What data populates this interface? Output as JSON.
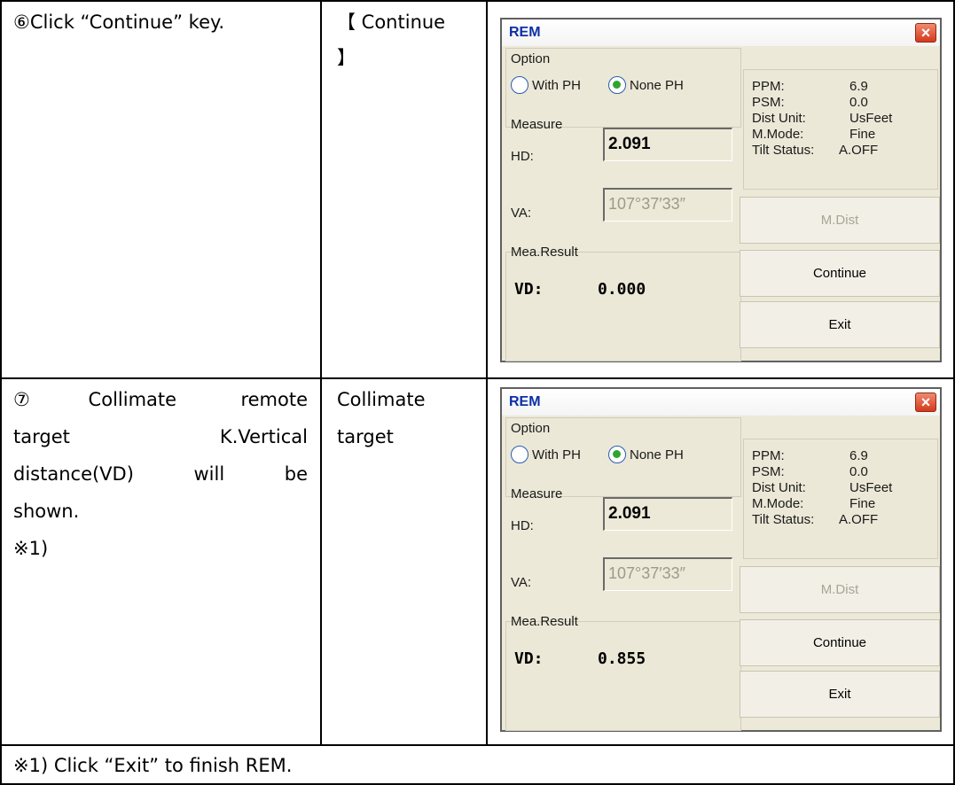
{
  "rows": [
    {
      "step": [
        "⑥Click “Continue” key."
      ],
      "key": [
        "【 Continue",
        "】"
      ],
      "screen": {
        "title": "REM",
        "close_glyph": "×",
        "option_label": "Option",
        "radio_with_ph": "With PH",
        "radio_none_ph": "None PH",
        "measure_label": "Measure",
        "hd_label": "HD:",
        "hd_value": "2.091",
        "va_label": "VA:",
        "va_value": "107°37′33″",
        "mea_result_label": "Mea.Result",
        "vd_label": "VD:",
        "vd_value": "0.000",
        "info_labels": [
          "PPM:",
          "PSM:",
          "Dist Unit:",
          "M.Mode:",
          "Tilt Status:"
        ],
        "info_values": [
          "6.9",
          "0.0",
          "UsFeet",
          "Fine",
          "A.OFF"
        ],
        "btn_mdist": "M.Dist",
        "btn_continue": "Continue",
        "btn_exit": "Exit"
      }
    },
    {
      "step": [
        "⑦Collimate remote",
        "target K.Vertical",
        "distance(VD) will be",
        "shown.",
        "※1)"
      ],
      "key": [
        "Collimate",
        "target"
      ],
      "screen": {
        "title": "REM",
        "close_glyph": "×",
        "option_label": "Option",
        "radio_with_ph": "With PH",
        "radio_none_ph": "None PH",
        "measure_label": "Measure",
        "hd_label": "HD:",
        "hd_value": "2.091",
        "va_label": "VA:",
        "va_value": "107°37′33″",
        "mea_result_label": "Mea.Result",
        "vd_label": "VD:",
        "vd_value": "0.855",
        "info_labels": [
          "PPM:",
          "PSM:",
          "Dist Unit:",
          "M.Mode:",
          "Tilt Status:"
        ],
        "info_values": [
          "6.9",
          "0.0",
          "UsFeet",
          "Fine",
          "A.OFF"
        ],
        "btn_mdist": "M.Dist",
        "btn_continue": "Continue",
        "btn_exit": "Exit"
      }
    }
  ],
  "footnote": "※1) Click “Exit” to finish REM.",
  "colors": {
    "title_text": "#0b2fa6",
    "close_red": "#d5391b",
    "window_bg": "#ece9d8",
    "radio_green": "#2fa52f"
  }
}
